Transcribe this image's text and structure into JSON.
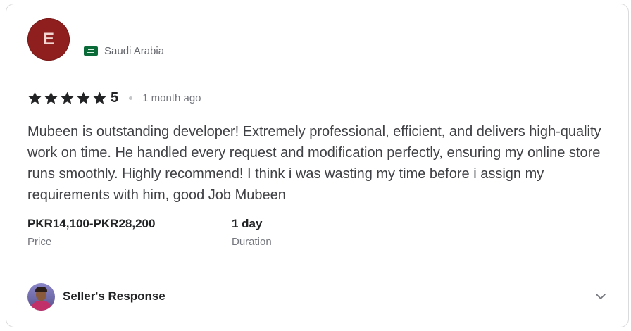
{
  "reviewer": {
    "initial": "E",
    "avatar_color": "#8f1f1f",
    "country": "Saudi Arabia",
    "flag_icon": "saudi-arabia-flag-icon"
  },
  "rating": {
    "stars": 5,
    "value": "5",
    "time_ago": "1 month ago"
  },
  "review_text": "Mubeen is outstanding developer! Extremely professional, efficient, and delivers high-quality work on time. He handled every request and modification perfectly, ensuring my online store runs smoothly. Highly recommend! I think i was wasting my time before i assign my requirements with him, good Job Mubeen",
  "stats": {
    "price_value": "PKR14,100-PKR28,200",
    "price_label": "Price",
    "duration_value": "1 day",
    "duration_label": "Duration"
  },
  "seller_response": {
    "label": "Seller's Response",
    "expand_icon": "chevron-down-icon"
  }
}
